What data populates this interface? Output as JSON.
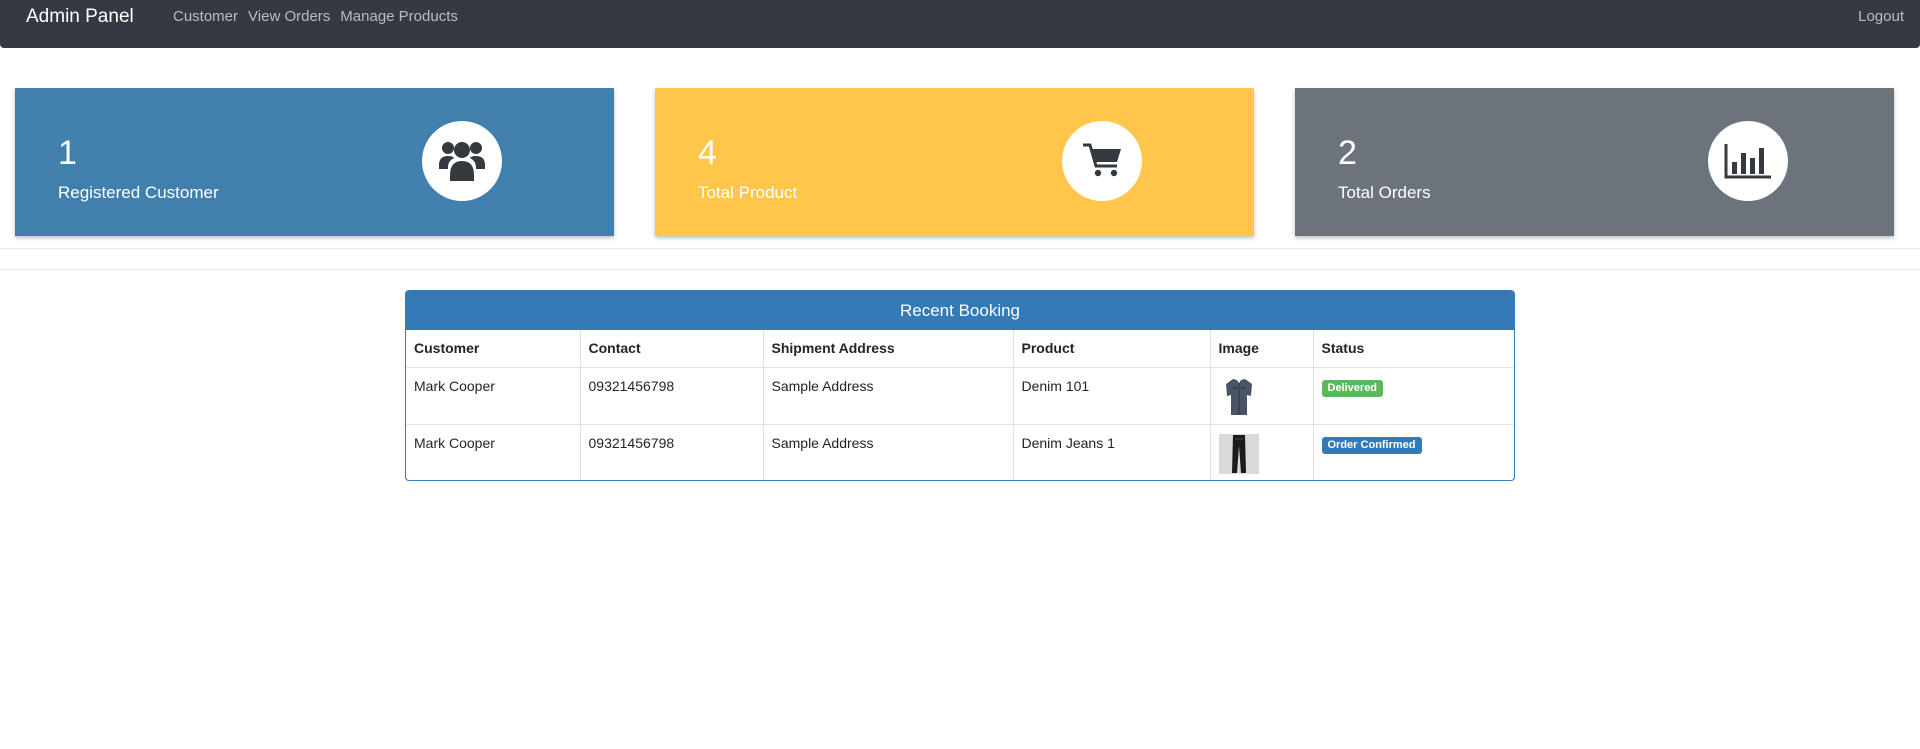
{
  "navbar": {
    "brand": "Admin Panel",
    "links": [
      "Customer",
      "View Orders",
      "Manage Products"
    ],
    "logout": "Logout"
  },
  "cards": [
    {
      "value": "1",
      "label": "Registered Customer",
      "icon": "users-icon",
      "color": "#417fad"
    },
    {
      "value": "4",
      "label": "Total Product",
      "icon": "cart-icon",
      "color": "#ffc64b"
    },
    {
      "value": "2",
      "label": "Total Orders",
      "icon": "bar-chart-icon",
      "color": "#6c737b"
    }
  ],
  "booking": {
    "title": "Recent Booking",
    "columns": [
      "Customer",
      "Contact",
      "Shipment Address",
      "Product",
      "Image",
      "Status"
    ],
    "rows": [
      {
        "customer": "Mark Cooper",
        "contact": "09321456798",
        "address": "Sample Address",
        "product": "Denim 101",
        "image": "shirt-image",
        "status": "Delivered",
        "status_color": "#5cb85c"
      },
      {
        "customer": "Mark Cooper",
        "contact": "09321456798",
        "address": "Sample Address",
        "product": "Denim Jeans 1",
        "image": "jeans-image",
        "status": "Order Confirmed",
        "status_color": "#337ab7"
      }
    ]
  }
}
